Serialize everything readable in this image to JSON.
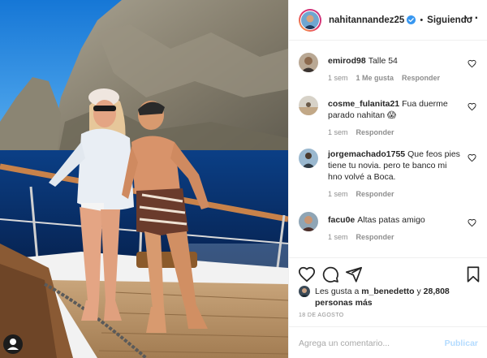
{
  "post": {
    "owner": "nahitannandez25",
    "separator": "•",
    "follow_state": "Siguiendo",
    "photo_alt": "Pareja en la proa de un velero frente a un acantilado"
  },
  "comments": [
    {
      "user": "emirod98",
      "text": "Talle 54",
      "time": "1 sem",
      "likes": "1 Me gusta",
      "reply": "Responder"
    },
    {
      "user": "cosme_fulanita21",
      "text": "Fua duerme parado nahitan 😱",
      "time": "1 sem",
      "likes": "",
      "reply": "Responder"
    },
    {
      "user": "jorgemachado1755",
      "text": "Que feos pies tiene tu novia. pero te banco mi hno volvé a Boca.",
      "time": "1 sem",
      "likes": "",
      "reply": "Responder"
    },
    {
      "user": "facu0e",
      "text": "Altas patas amigo",
      "time": "1 sem",
      "likes": "",
      "reply": "Responder"
    }
  ],
  "likes": {
    "prefix": "Les gusta a",
    "first_user": "m_benedetto",
    "conjunction": "y",
    "others": "28,808 personas más"
  },
  "date": "18 DE AGOSTO",
  "composer": {
    "placeholder": "Agrega un comentario...",
    "publish_label": "Publicar"
  },
  "icons": {
    "more": "more-options-icon",
    "verified": "verified-badge-icon",
    "like": "heart-icon",
    "comment": "comment-bubble-icon",
    "share": "paper-plane-icon",
    "save": "bookmark-icon"
  },
  "colors": {
    "text": "#262626",
    "muted": "#8e8e8e",
    "verified": "#3897f0",
    "publish_disabled": "#b3dbff",
    "divider": "#efefef"
  }
}
